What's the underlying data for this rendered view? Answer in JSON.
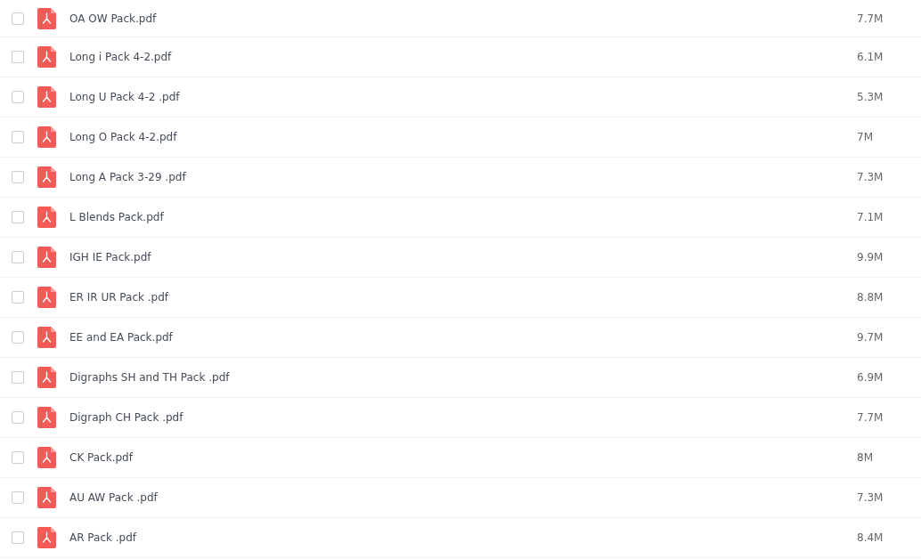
{
  "files": [
    {
      "name": "OA OW Pack.pdf",
      "size": "7.7M",
      "checked": false
    },
    {
      "name": "Long i Pack 4-2.pdf",
      "size": "6.1M",
      "checked": false
    },
    {
      "name": "Long U Pack 4-2 .pdf",
      "size": "5.3M",
      "checked": false
    },
    {
      "name": "Long O Pack 4-2.pdf",
      "size": "7M",
      "checked": false
    },
    {
      "name": "Long A Pack 3-29 .pdf",
      "size": "7.3M",
      "checked": false
    },
    {
      "name": "L Blends Pack.pdf",
      "size": "7.1M",
      "checked": false
    },
    {
      "name": "IGH IE Pack.pdf",
      "size": "9.9M",
      "checked": false
    },
    {
      "name": "ER IR UR Pack .pdf",
      "size": "8.8M",
      "checked": false
    },
    {
      "name": "EE and EA Pack.pdf",
      "size": "9.7M",
      "checked": false
    },
    {
      "name": "Digraphs SH and TH Pack .pdf",
      "size": "6.9M",
      "checked": false
    },
    {
      "name": "Digraph CH Pack .pdf",
      "size": "7.7M",
      "checked": false
    },
    {
      "name": "CK Pack.pdf",
      "size": "8M",
      "checked": false
    },
    {
      "name": "AU AW Pack .pdf",
      "size": "7.3M",
      "checked": false
    },
    {
      "name": "AR Pack .pdf",
      "size": "8.4M",
      "checked": false
    }
  ]
}
